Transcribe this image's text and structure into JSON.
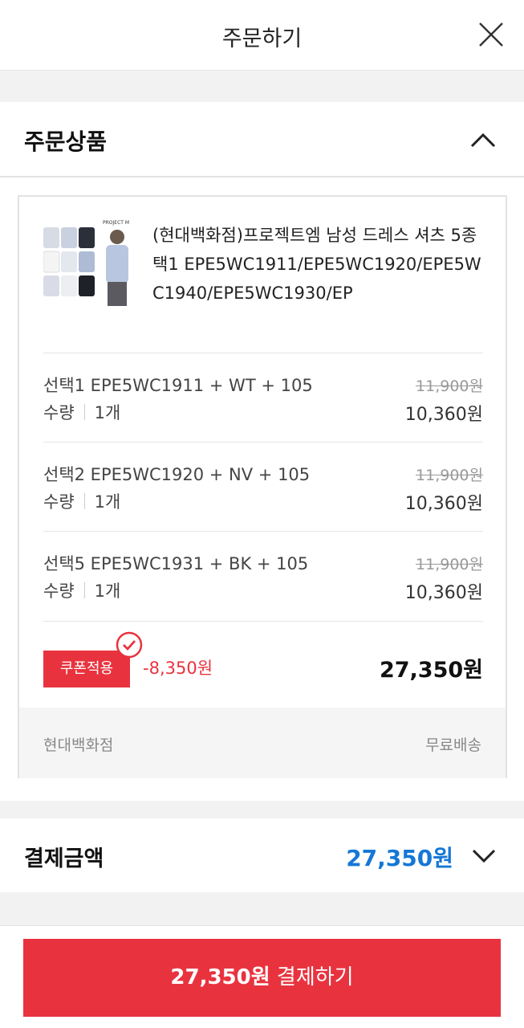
{
  "header": {
    "title": "주문하기"
  },
  "order_section": {
    "title": "주문상품",
    "product": {
      "brand_logo": "PROJECT M",
      "name": "(현대백화점)프로젝트엠 남성 드레스 셔츠 5종 택1 EPE5WC1911/EPE5WC1920/EPE5WC1940/EPE5WC1930/EP"
    },
    "options": [
      {
        "label": "선택1 EPE5WC1911 + WT + 105",
        "qty_label": "수량",
        "qty": "1개",
        "original_price": "11,900원",
        "sale_price": "10,360원"
      },
      {
        "label": "선택2 EPE5WC1920 + NV + 105",
        "qty_label": "수량",
        "qty": "1개",
        "original_price": "11,900원",
        "sale_price": "10,360원"
      },
      {
        "label": "선택5 EPE5WC1931 + BK + 105",
        "qty_label": "수량",
        "qty": "1개",
        "original_price": "11,900원",
        "sale_price": "10,360원"
      }
    ],
    "coupon": {
      "badge": "쿠폰적용",
      "discount": "-8,350원",
      "total": "27,350원"
    },
    "store": {
      "name": "현대백화점",
      "shipping": "무료배송"
    }
  },
  "payment_section": {
    "title": "결제금액",
    "amount": "27,350원"
  },
  "pay_button": {
    "amount": "27,350원",
    "label": "결제하기"
  },
  "colors": {
    "accent_red": "#e8333f",
    "amount_blue": "#1577d6"
  }
}
